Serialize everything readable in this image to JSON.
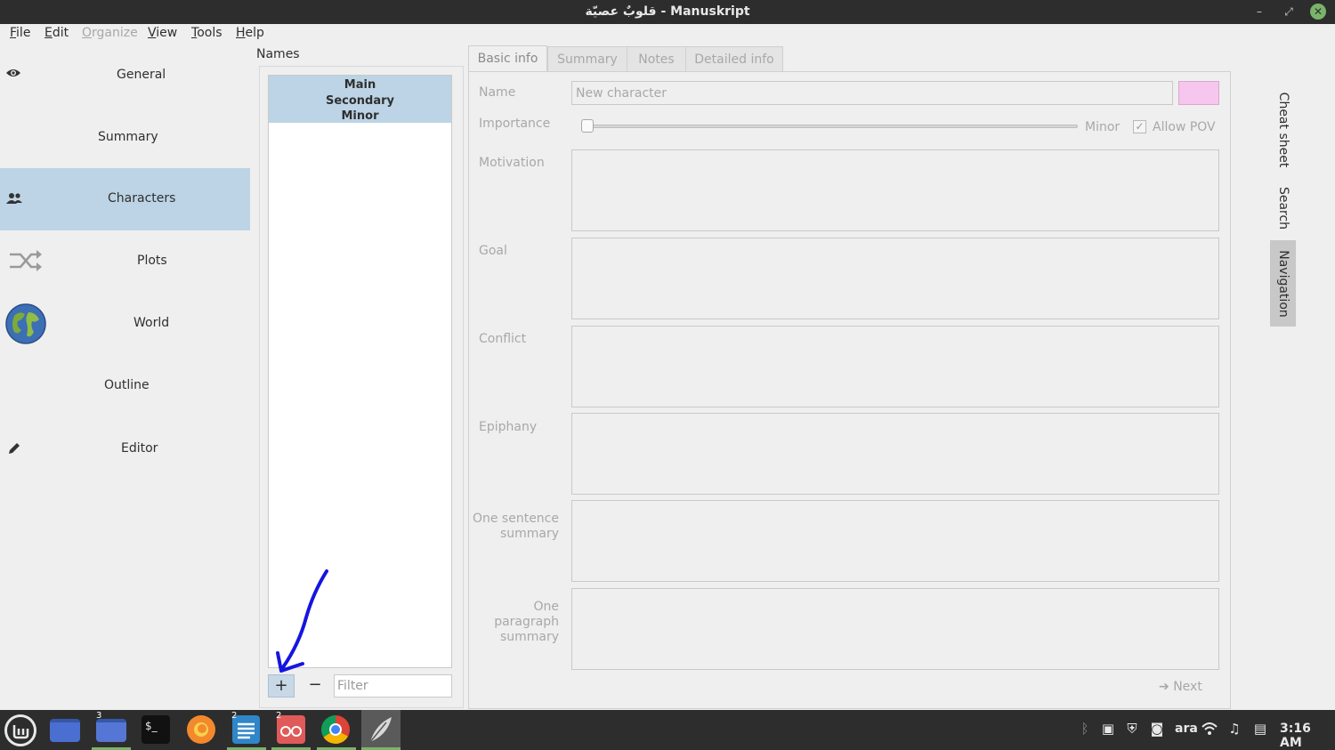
{
  "window": {
    "title": "قلوبٌ عصيّة - Manuskript",
    "buttons": [
      "minimize-icon",
      "restore-icon",
      "close-icon"
    ]
  },
  "menu": {
    "items": [
      {
        "label": "File",
        "enabled": true
      },
      {
        "label": "Edit",
        "enabled": true
      },
      {
        "label": "Organize",
        "enabled": false
      },
      {
        "label": "View",
        "enabled": true
      },
      {
        "label": "Tools",
        "enabled": true
      },
      {
        "label": "Help",
        "enabled": true
      }
    ]
  },
  "sidebar": {
    "items": [
      {
        "label": "General",
        "icon": "eye-icon",
        "active": false
      },
      {
        "label": "Summary",
        "icon": "",
        "active": false
      },
      {
        "label": "Characters",
        "icon": "people-icon",
        "active": true
      },
      {
        "label": "Plots",
        "icon": "shuffle-arrows-icon",
        "active": false
      },
      {
        "label": "World",
        "icon": "globe-icon",
        "active": false
      },
      {
        "label": "Outline",
        "icon": "",
        "active": false
      },
      {
        "label": "Editor",
        "icon": "pencil-icon",
        "active": false
      }
    ]
  },
  "names_panel": {
    "heading": "Names",
    "groups": [
      "Main",
      "Secondary",
      "Minor"
    ],
    "add_label": "+",
    "remove_label": "−",
    "filter_placeholder": "Filter"
  },
  "tabs": {
    "items": [
      "Basic info",
      "Summary",
      "Notes",
      "Detailed info"
    ],
    "active": "Basic info"
  },
  "basic_info": {
    "name_label": "Name",
    "name_placeholder": "New character",
    "name_color": "#f6c6ee",
    "importance_label": "Importance",
    "importance_value": "Minor",
    "allow_pov_label": "Allow POV",
    "allow_pov_checked": true,
    "motivation_label": "Motivation",
    "goal_label": "Goal",
    "conflict_label": "Conflict",
    "epiphany_label": "Epiphany",
    "one_sentence_label_1": "One sentence",
    "one_sentence_label_2": "summary",
    "one_paragraph_label_1": "One paragraph",
    "one_paragraph_label_2": "summary",
    "next_label": "Next"
  },
  "dock": {
    "tabs": [
      {
        "label": "Cheat sheet",
        "active": false
      },
      {
        "label": "Search",
        "active": false
      },
      {
        "label": "Navigation",
        "active": true
      }
    ]
  },
  "taskbar": {
    "apps": [
      {
        "name": "mint-menu-icon"
      },
      {
        "name": "show-desktop-icon"
      },
      {
        "name": "files-icon",
        "badge": "3"
      },
      {
        "name": "terminal-icon"
      },
      {
        "name": "firefox-icon"
      },
      {
        "name": "text-editor-icon",
        "badge": "2"
      },
      {
        "name": "reader-icon",
        "badge": "2"
      },
      {
        "name": "chrome-icon"
      },
      {
        "name": "manuskript-icon"
      }
    ],
    "tray": {
      "keyboard_layout": "ara",
      "clock": "3:16 AM"
    }
  },
  "colors": {
    "accent": "#bcd4e5",
    "taskbar": "#2d2d2d",
    "annotation": "#1515e0"
  }
}
